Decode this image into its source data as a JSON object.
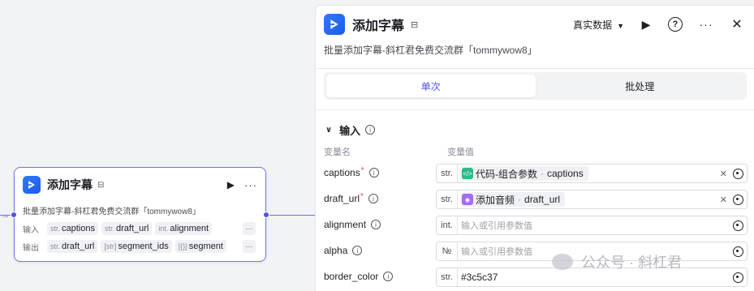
{
  "node": {
    "title": "添加字幕",
    "description": "批量添加字幕-斜杠君免费交流群「tommywow8」",
    "inputs_label": "输入",
    "outputs_label": "输出",
    "inputs": [
      {
        "type": "str.",
        "name": "captions"
      },
      {
        "type": "str.",
        "name": "draft_url"
      },
      {
        "type": "int.",
        "name": "alignment"
      }
    ],
    "outputs": [
      {
        "type": "str.",
        "name": "draft_url"
      },
      {
        "type": "[str]",
        "name": "segment_ids"
      },
      {
        "type": "[{}]",
        "name": "segment"
      }
    ],
    "more": "···"
  },
  "panel": {
    "title": "添加字幕",
    "description": "批量添加字幕-斜杠君免费交流群「tommywow8」",
    "data_mode": "真实数据",
    "tabs": [
      "单次",
      "批处理"
    ],
    "active_tab": 0,
    "section_title": "输入",
    "col_name": "变量名",
    "col_value": "变量值",
    "params": [
      {
        "name": "captions",
        "required": true,
        "type": "str.",
        "ref_source": "代码-组合参数",
        "ref_var": "captions",
        "ref_color": "#2fb989"
      },
      {
        "name": "draft_url",
        "required": true,
        "type": "str.",
        "ref_source": "添加音频",
        "ref_var": "draft_url",
        "ref_color": "#a66bf0"
      },
      {
        "name": "alignment",
        "required": false,
        "type": "int.",
        "placeholder": "输入或引用参数值"
      },
      {
        "name": "alpha",
        "required": false,
        "type": "№",
        "placeholder": "输入或引用参数值"
      },
      {
        "name": "border_color",
        "required": false,
        "type": "str.",
        "value": "#3c5c37"
      }
    ]
  },
  "watermark": "公众号 · 斜杠君"
}
